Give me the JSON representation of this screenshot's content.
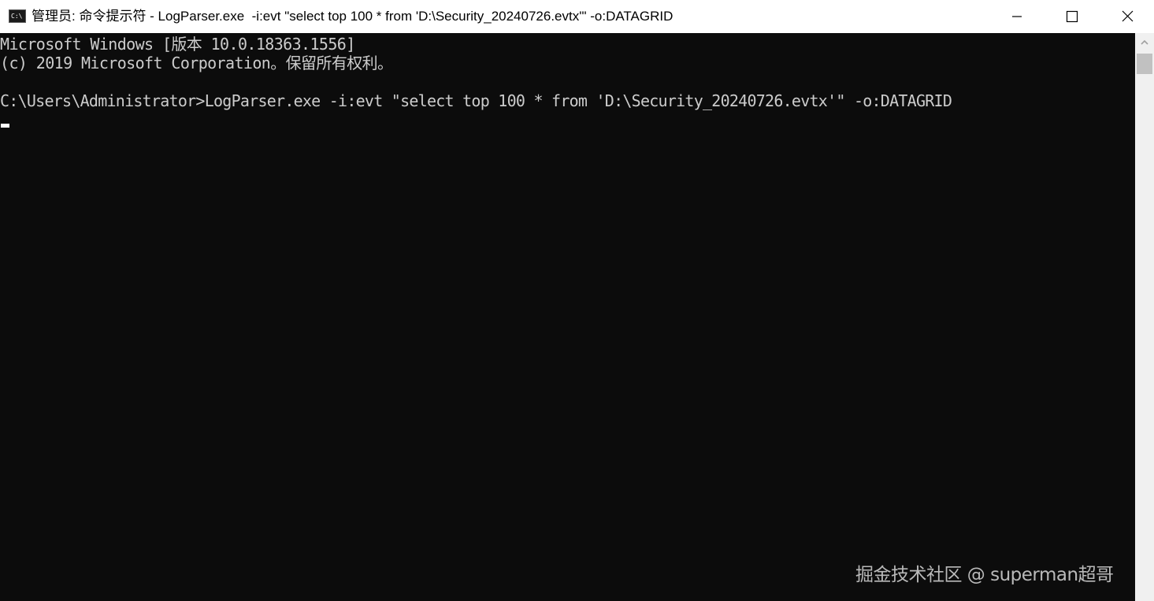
{
  "window": {
    "title": "管理员: 命令提示符 - LogParser.exe  -i:evt \"select top 100 * from 'D:\\Security_20240726.evtx'\" -o:DATAGRID",
    "icon": "cmd-icon",
    "icon_text": "C:\\",
    "buttons": {
      "minimize": "minimize-icon",
      "maximize": "maximize-icon",
      "close": "close-icon"
    }
  },
  "console": {
    "background": "#0c0c0c",
    "foreground": "#cccccc",
    "lines": [
      "Microsoft Windows [版本 10.0.18363.1556]",
      "(c) 2019 Microsoft Corporation。保留所有权利。",
      "",
      "C:\\Users\\Administrator>LogParser.exe -i:evt \"select top 100 * from 'D:\\Security_20240726.evtx'\" -o:DATAGRID"
    ]
  },
  "watermark": "掘金技术社区 @ superman超哥"
}
